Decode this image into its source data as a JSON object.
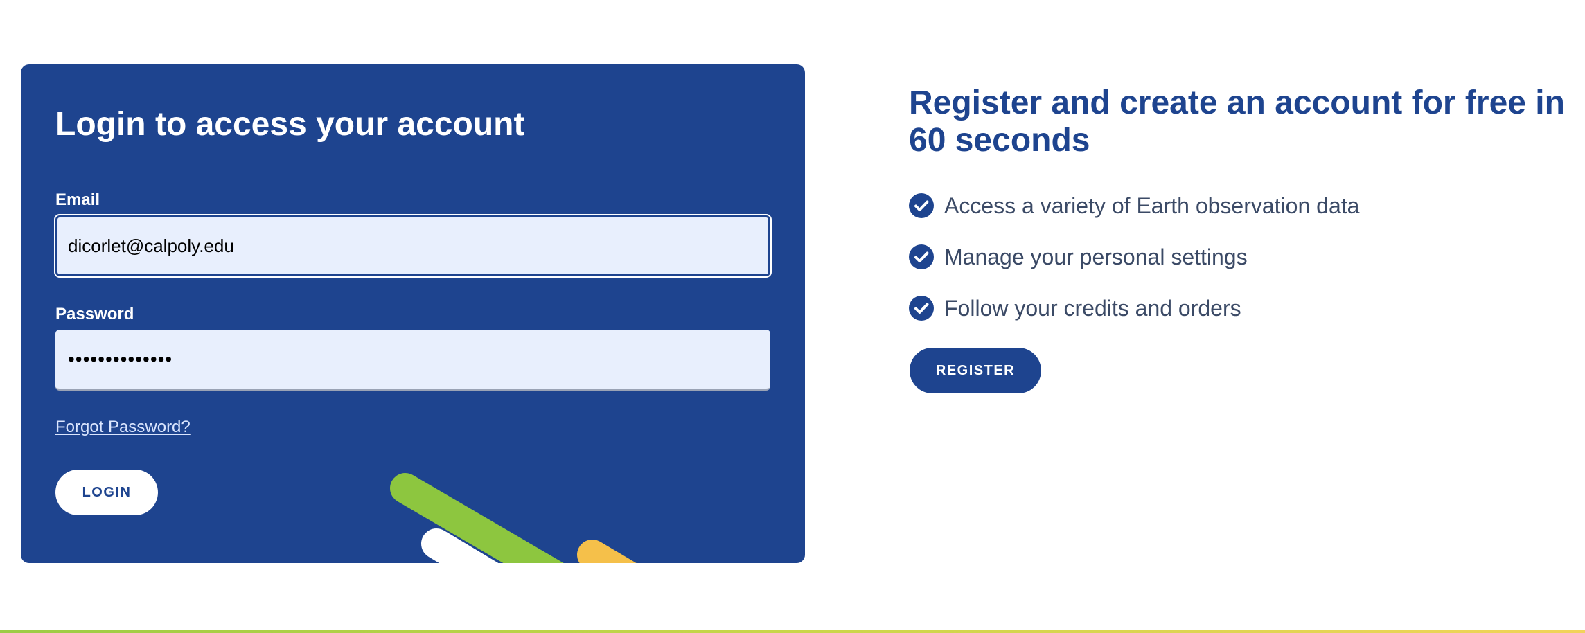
{
  "login": {
    "title": "Login to access your account",
    "email_label": "Email",
    "email_value": "dicorlet@calpoly.edu",
    "password_label": "Password",
    "password_value": "••••••••••••••",
    "forgot_password": "Forgot Password?",
    "login_button": "LOGIN"
  },
  "register": {
    "title": "Register and create an account for free in 60 seconds",
    "benefits": [
      {
        "icon": "check-circle-icon",
        "text": "Access a variety of Earth observation data"
      },
      {
        "icon": "check-circle-icon",
        "text": "Manage your personal settings"
      },
      {
        "icon": "check-circle-icon",
        "text": "Follow your credits and orders"
      }
    ],
    "register_button": "REGISTER"
  },
  "colors": {
    "brand_blue": "#1e448f",
    "input_bg": "#e8effd",
    "accent_green": "#8dc63f",
    "accent_yellow": "#f5c04a",
    "body_text": "#3b4a66"
  }
}
